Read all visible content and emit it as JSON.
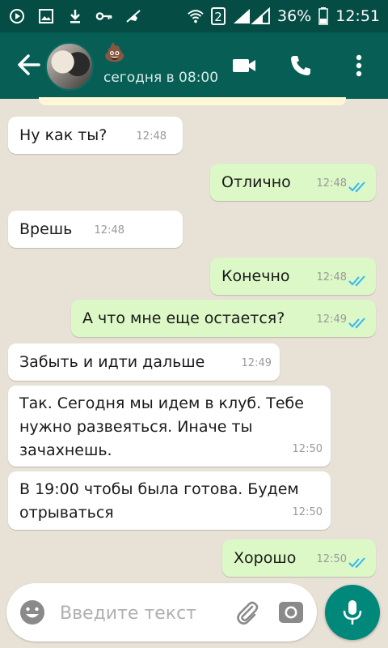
{
  "status_bar": {
    "battery": "36%",
    "clock": "12:51",
    "sim": "2",
    "icons": [
      "play-icon",
      "image-icon",
      "download-icon",
      "key-icon",
      "mute-icon",
      "wifi-icon",
      "signal-icon",
      "battery-icon"
    ]
  },
  "header": {
    "contact_emoji": "💩",
    "status": "сегодня в 08:00",
    "icons": [
      "back-arrow-icon",
      "video-call-icon",
      "phone-icon",
      "more-vert-icon"
    ]
  },
  "messages": [
    {
      "direction": "in",
      "text": "Ну как ты?",
      "time": "12:48"
    },
    {
      "direction": "out",
      "text": "Отлично",
      "time": "12:48",
      "read": true
    },
    {
      "direction": "in",
      "text": "Врешь",
      "time": "12:48"
    },
    {
      "direction": "out",
      "text": "Конечно",
      "time": "12:48",
      "read": true
    },
    {
      "direction": "out",
      "text": "А что мне еще остается?",
      "time": "12:49",
      "read": true
    },
    {
      "direction": "in",
      "text": "Забыть и идти дальше",
      "time": "12:49"
    },
    {
      "direction": "in",
      "text": "Так. Сегодня мы идем в клуб. Тебе нужно развеяться. Иначе ты зачахнешь.",
      "time": "12:50"
    },
    {
      "direction": "in",
      "text": "В 19:00 чтобы была готова. Будем отрываться",
      "time": "12:50"
    },
    {
      "direction": "out",
      "text": "Хорошо",
      "time": "12:50",
      "read": true
    }
  ],
  "input": {
    "placeholder": "Введите текст",
    "value": ""
  },
  "colors": {
    "status_bar": "#054d44",
    "header": "#075e54",
    "outgoing_bubble": "#dcf8c6",
    "incoming_bubble": "#ffffff",
    "read_ticks": "#34b7f1",
    "mic_button": "#00897b"
  }
}
